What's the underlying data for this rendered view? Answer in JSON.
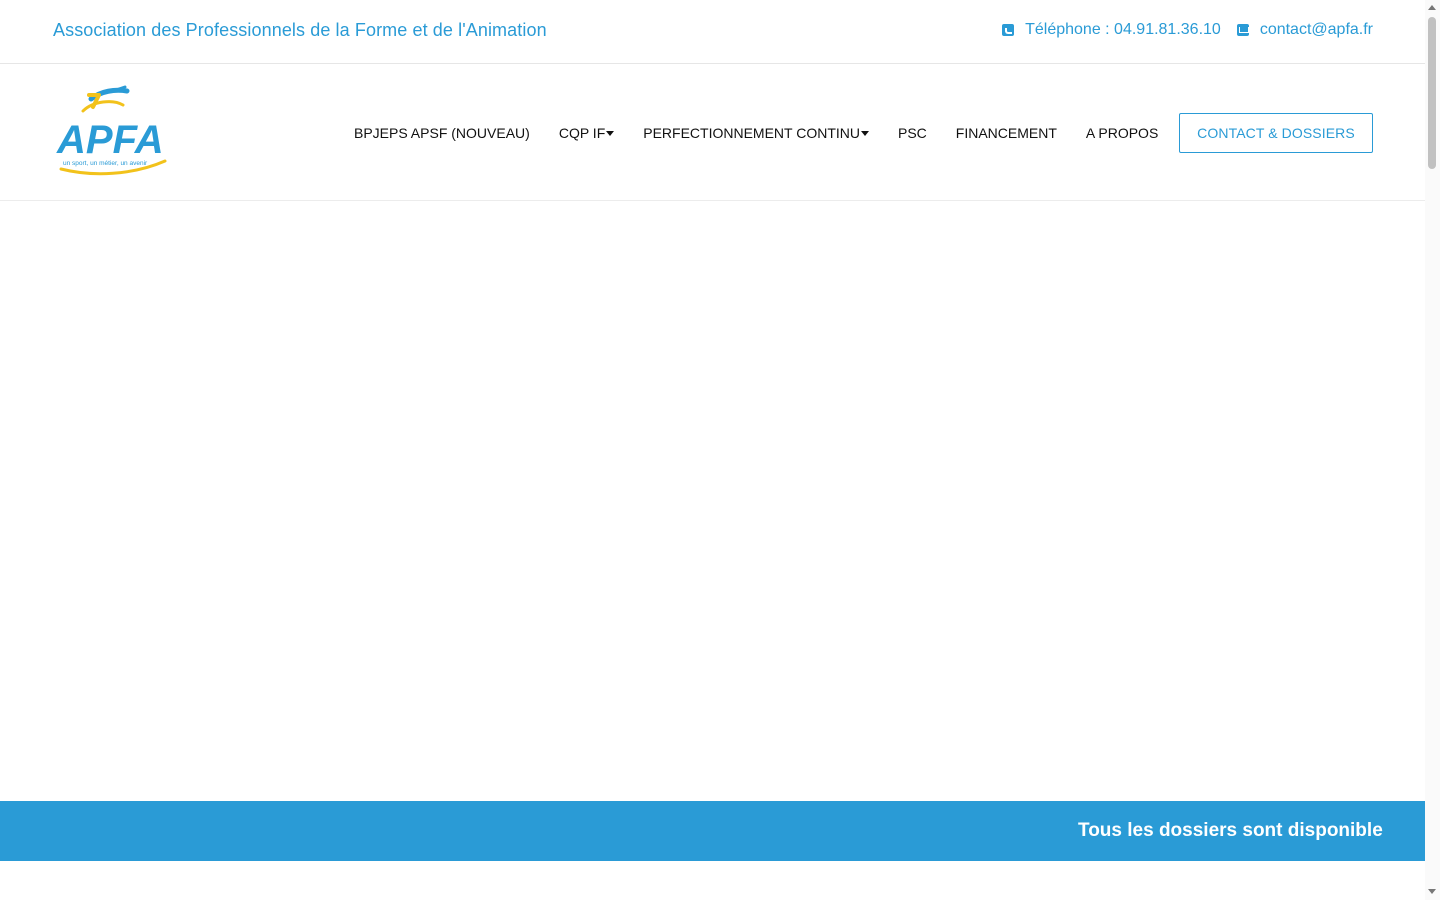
{
  "topbar": {
    "org_name": "Association des Professionnels de la Forme et de l'Animation",
    "phone_label": "Téléphone : 04.91.81.36.10",
    "email": "contact@apfa.fr",
    "phone_icon": "phone-icon",
    "email_icon": "envelope-icon"
  },
  "header": {
    "logo": {
      "text": "APFA",
      "tagline": "un sport, un métier, un avenir"
    },
    "nav": [
      {
        "label": "BPJEPS APSF (NOUVEAU)",
        "has_dropdown": false
      },
      {
        "label": "CQP IF",
        "has_dropdown": true
      },
      {
        "label": "PERFECTIONNEMENT CONTINU",
        "has_dropdown": true
      },
      {
        "label": "PSC",
        "has_dropdown": false
      },
      {
        "label": "FINANCEMENT",
        "has_dropdown": false
      },
      {
        "label": "A PROPOS",
        "has_dropdown": false
      }
    ],
    "cta_label": "CONTACT & DOSSIERS"
  },
  "banner": {
    "text": "Tous les dossiers sont disponibles"
  },
  "colors": {
    "accent": "#2a9bd6",
    "logo_yellow": "#f2c21b",
    "text": "#111111"
  }
}
